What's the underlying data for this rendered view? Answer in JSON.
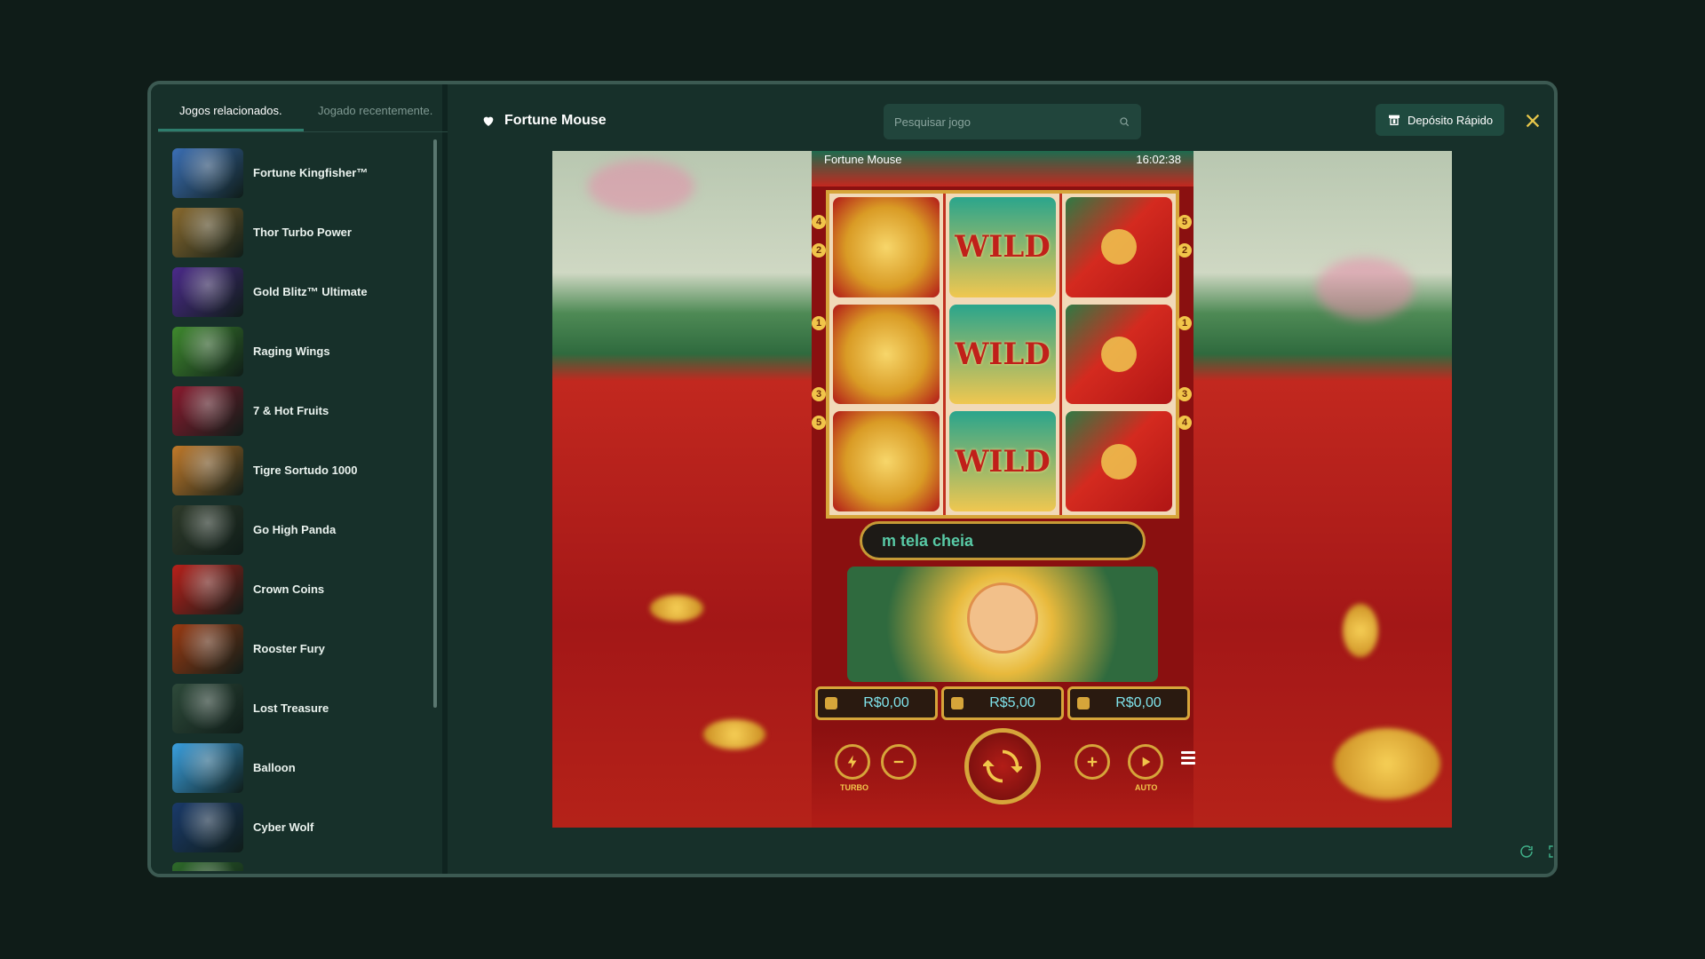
{
  "sidebar": {
    "tabs": [
      {
        "label": "Jogos relacionados."
      },
      {
        "label": "Jogado recentemente."
      }
    ],
    "games": [
      {
        "name": "Fortune Kingfisher™",
        "thumb_color": "#3b6fb5"
      },
      {
        "name": "Thor Turbo Power",
        "thumb_color": "#8a6a2e"
      },
      {
        "name": "Gold Blitz™ Ultimate",
        "thumb_color": "#4b2a8a"
      },
      {
        "name": "Raging Wings",
        "thumb_color": "#3f8a2e"
      },
      {
        "name": "7 & Hot Fruits",
        "thumb_color": "#8a1a2e"
      },
      {
        "name": "Tigre Sortudo 1000",
        "thumb_color": "#c27a2a"
      },
      {
        "name": "Go High Panda",
        "thumb_color": "#2e3a2a"
      },
      {
        "name": "Crown Coins",
        "thumb_color": "#b8201a"
      },
      {
        "name": "Rooster Fury",
        "thumb_color": "#9a3a12"
      },
      {
        "name": "Lost Treasure",
        "thumb_color": "#2e4a3a"
      },
      {
        "name": "Balloon",
        "thumb_color": "#3aa0e0"
      },
      {
        "name": "Cyber Wolf",
        "thumb_color": "#1a3a6a"
      },
      {
        "name": "",
        "thumb_color": "#2e6a2a"
      }
    ]
  },
  "header": {
    "title": "Fortune Mouse",
    "search_placeholder": "Pesquisar jogo",
    "deposit_label": "Depósito Rápido"
  },
  "game": {
    "label": "Fortune Mouse",
    "clock": "16:02:38",
    "banner_text": "m tela cheia",
    "wild_text": "WILD",
    "balances": [
      "R$0,00",
      "R$5,00",
      "R$0,00"
    ],
    "turbo_label": "TURBO",
    "auto_label": "AUTO",
    "line_numbers_left": [
      "4",
      "2",
      "1",
      "3",
      "5"
    ],
    "line_numbers_right": [
      "5",
      "2",
      "1",
      "3",
      "4"
    ]
  },
  "colors": {
    "accent": "#2e7d6d",
    "background": "#0f1c18",
    "panel": "#17302a",
    "gold": "#d6a53a"
  }
}
